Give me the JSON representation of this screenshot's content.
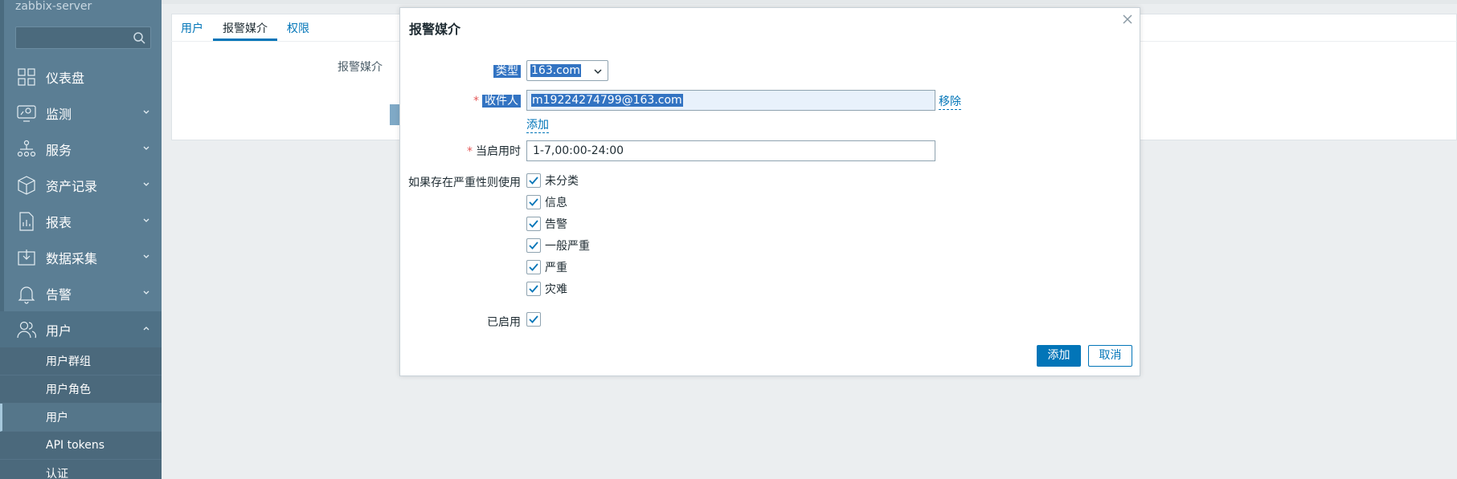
{
  "app": {
    "brand": "zabbix-server"
  },
  "sidebar": {
    "search_placeholder": "",
    "items": [
      {
        "label": "仪表盘",
        "icon": "dashboard-icon"
      },
      {
        "label": "监测",
        "icon": "monitoring-icon"
      },
      {
        "label": "服务",
        "icon": "services-icon"
      },
      {
        "label": "资产记录",
        "icon": "inventory-icon"
      },
      {
        "label": "报表",
        "icon": "reports-icon"
      },
      {
        "label": "数据采集",
        "icon": "data-collection-icon"
      },
      {
        "label": "告警",
        "icon": "alerts-icon"
      },
      {
        "label": "用户",
        "icon": "users-icon"
      }
    ],
    "sub_items": [
      "用户群组",
      "用户角色",
      "用户",
      "API tokens",
      "认证"
    ]
  },
  "main": {
    "tabs": [
      "用户",
      "报警媒介",
      "权限"
    ],
    "media_label": "报警媒介"
  },
  "dialog": {
    "title": "报警媒介",
    "type_label": "类型",
    "type_value": "163.com",
    "recipient_label": "收件人",
    "recipient_value": "m19224274799@163.com",
    "remove_link": "移除",
    "add_link": "添加",
    "period_label": "当启用时",
    "period_value": "1-7,00:00-24:00",
    "severity_label": "如果存在严重性则使用",
    "severities": [
      "未分类",
      "信息",
      "告警",
      "一般严重",
      "严重",
      "灾难"
    ],
    "enabled_label": "已启用",
    "add_button": "添加",
    "cancel_button": "取消"
  },
  "colors": {
    "accent": "#0275b8",
    "sidebar": "#5b7e94",
    "selection": "#3273c2",
    "required": "#e45959"
  }
}
